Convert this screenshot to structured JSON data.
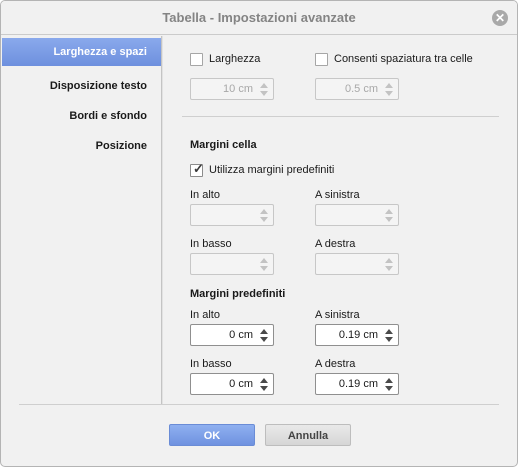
{
  "window": {
    "title": "Tabella - Impostazioni avanzate",
    "close_glyph": "✕"
  },
  "sidebar": {
    "items": [
      {
        "label": "Larghezza e spazi",
        "active": true
      },
      {
        "label": "Disposizione testo",
        "active": false
      },
      {
        "label": "Bordi e sfondo",
        "active": false
      },
      {
        "label": "Posizione",
        "active": false
      }
    ]
  },
  "width_section": {
    "width_label": "Larghezza",
    "width_checked": false,
    "width_value": "10 cm",
    "spacing_label": "Consenti spaziatura tra celle",
    "spacing_checked": false,
    "spacing_value": "0.5 cm"
  },
  "cell_margins": {
    "header": "Margini cella",
    "use_default_label": "Utilizza margini predefiniti",
    "use_default_checked": true,
    "top_label": "In alto",
    "left_label": "A sinistra",
    "bottom_label": "In basso",
    "right_label": "A destra",
    "top_value": "",
    "left_value": "",
    "bottom_value": "",
    "right_value": ""
  },
  "default_margins": {
    "header": "Margini predefiniti",
    "top_label": "In alto",
    "top_value": "0 cm",
    "left_label": "A sinistra",
    "left_value": "0.19 cm",
    "bottom_label": "In basso",
    "bottom_value": "0 cm",
    "right_label": "A destra",
    "right_value": "0.19 cm"
  },
  "footer": {
    "ok_label": "OK",
    "cancel_label": "Annulla"
  },
  "colors": {
    "accent": "#7d9ee5",
    "panel_bg": "#f1f1f1"
  }
}
